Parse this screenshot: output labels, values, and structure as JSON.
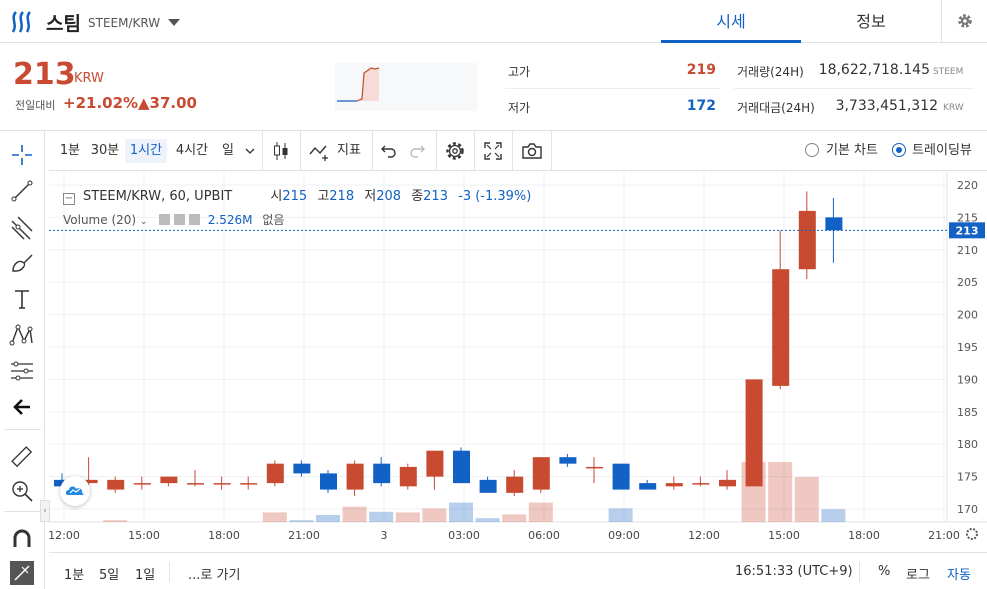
{
  "header": {
    "coin_name": "스팀",
    "coin_pair": "STEEM/KRW",
    "tabs": [
      "시세",
      "정보"
    ]
  },
  "summary": {
    "price": "213",
    "price_unit": "KRW",
    "change_label": "전일대비",
    "change_pct": "+21.02%",
    "change_abs": "▲37.00",
    "high_label": "고가",
    "high_value": "219",
    "low_label": "저가",
    "low_value": "172",
    "volume_label": "거래량(24H)",
    "volume_value": "18,622,718.145",
    "volume_unit": "STEEM",
    "amount_label": "거래대금(24H)",
    "amount_value": "3,733,451,312",
    "amount_unit": "KRW"
  },
  "toolbar": {
    "intervals": [
      "1분",
      "30분",
      "1시간",
      "4시간",
      "일"
    ],
    "active_interval": "1시간",
    "indicators_label": "지표",
    "basic_chart_label": "기본 차트",
    "trading_view_label": "트레이딩뷰"
  },
  "chart_legend": {
    "symbol": "STEEM/KRW, 60, UPBIT",
    "open_label": "시",
    "open": "215",
    "high_label": "고",
    "high": "218",
    "low_label": "저",
    "low": "208",
    "close_label": "종",
    "close": "213",
    "change": "-3 (-1.39%)",
    "volume_label": "Volume (20)",
    "volume_value": "2.526M",
    "volume_extra": "없음"
  },
  "bottom_bar": {
    "ranges": [
      "1분",
      "5일",
      "1일"
    ],
    "goto_label": "...로 가기",
    "clock": "16:51:33 (UTC+9)",
    "pct_label": "%",
    "log_label": "로그",
    "auto_label": "자동"
  },
  "colors": {
    "up": "#c84a31",
    "down": "#1261c4",
    "accent": "#1261c4"
  },
  "chart_data": {
    "type": "candlestick",
    "symbol": "STEEM/KRW",
    "interval": "60",
    "price_axis": [
      "220",
      "215",
      "210",
      "205",
      "200",
      "195",
      "190",
      "185",
      "180",
      "175",
      "170"
    ],
    "ylim": [
      168,
      222
    ],
    "time_axis": [
      "12:00",
      "15:00",
      "18:00",
      "21:00",
      "3",
      "03:00",
      "06:00",
      "09:00",
      "12:00",
      "15:00",
      "18:00",
      "21:00"
    ],
    "last_price_label": "213",
    "candles": [
      {
        "o": 174.5,
        "h": 175.5,
        "l": 173,
        "c": 173.5
      },
      {
        "o": 174,
        "h": 178,
        "l": 173.5,
        "c": 174.5
      },
      {
        "o": 173,
        "h": 175,
        "l": 172.5,
        "c": 174.5
      },
      {
        "o": 174,
        "h": 175,
        "l": 173,
        "c": 174
      },
      {
        "o": 174,
        "h": 175,
        "l": 173.5,
        "c": 175
      },
      {
        "o": 174,
        "h": 176,
        "l": 173.5,
        "c": 174
      },
      {
        "o": 174,
        "h": 175,
        "l": 173,
        "c": 174
      },
      {
        "o": 174,
        "h": 175,
        "l": 173,
        "c": 174
      },
      {
        "o": 174,
        "h": 177.5,
        "l": 173.5,
        "c": 177
      },
      {
        "o": 177,
        "h": 177.5,
        "l": 175,
        "c": 175.5
      },
      {
        "o": 175.5,
        "h": 176,
        "l": 172.5,
        "c": 173
      },
      {
        "o": 173,
        "h": 177.5,
        "l": 172,
        "c": 177
      },
      {
        "o": 177,
        "h": 178,
        "l": 173.5,
        "c": 174
      },
      {
        "o": 173.5,
        "h": 177,
        "l": 173,
        "c": 176.5
      },
      {
        "o": 175,
        "h": 177,
        "l": 173,
        "c": 179
      },
      {
        "o": 179,
        "h": 179.5,
        "l": 174,
        "c": 174
      },
      {
        "o": 174.5,
        "h": 175,
        "l": 172.5,
        "c": 172.5
      },
      {
        "o": 172.5,
        "h": 176,
        "l": 172,
        "c": 175
      },
      {
        "o": 173,
        "h": 178,
        "l": 172.5,
        "c": 178
      },
      {
        "o": 178,
        "h": 178.5,
        "l": 176.5,
        "c": 177
      },
      {
        "o": 176.5,
        "h": 178,
        "l": 174,
        "c": 176.5
      },
      {
        "o": 177,
        "h": 177,
        "l": 173,
        "c": 173
      },
      {
        "o": 174,
        "h": 174.5,
        "l": 173,
        "c": 173
      },
      {
        "o": 173.5,
        "h": 175,
        "l": 173,
        "c": 174
      },
      {
        "o": 174,
        "h": 175,
        "l": 173.5,
        "c": 174
      },
      {
        "o": 173.5,
        "h": 176,
        "l": 173,
        "c": 174.5
      },
      {
        "o": 173.5,
        "h": 190,
        "l": 173.5,
        "c": 190
      },
      {
        "o": 189,
        "h": 213,
        "l": 188.5,
        "c": 207
      },
      {
        "o": 207,
        "h": 219,
        "l": 205.5,
        "c": 216
      },
      {
        "o": 215,
        "h": 218,
        "l": 208,
        "c": 213
      }
    ],
    "volume_bars_visible": true
  }
}
